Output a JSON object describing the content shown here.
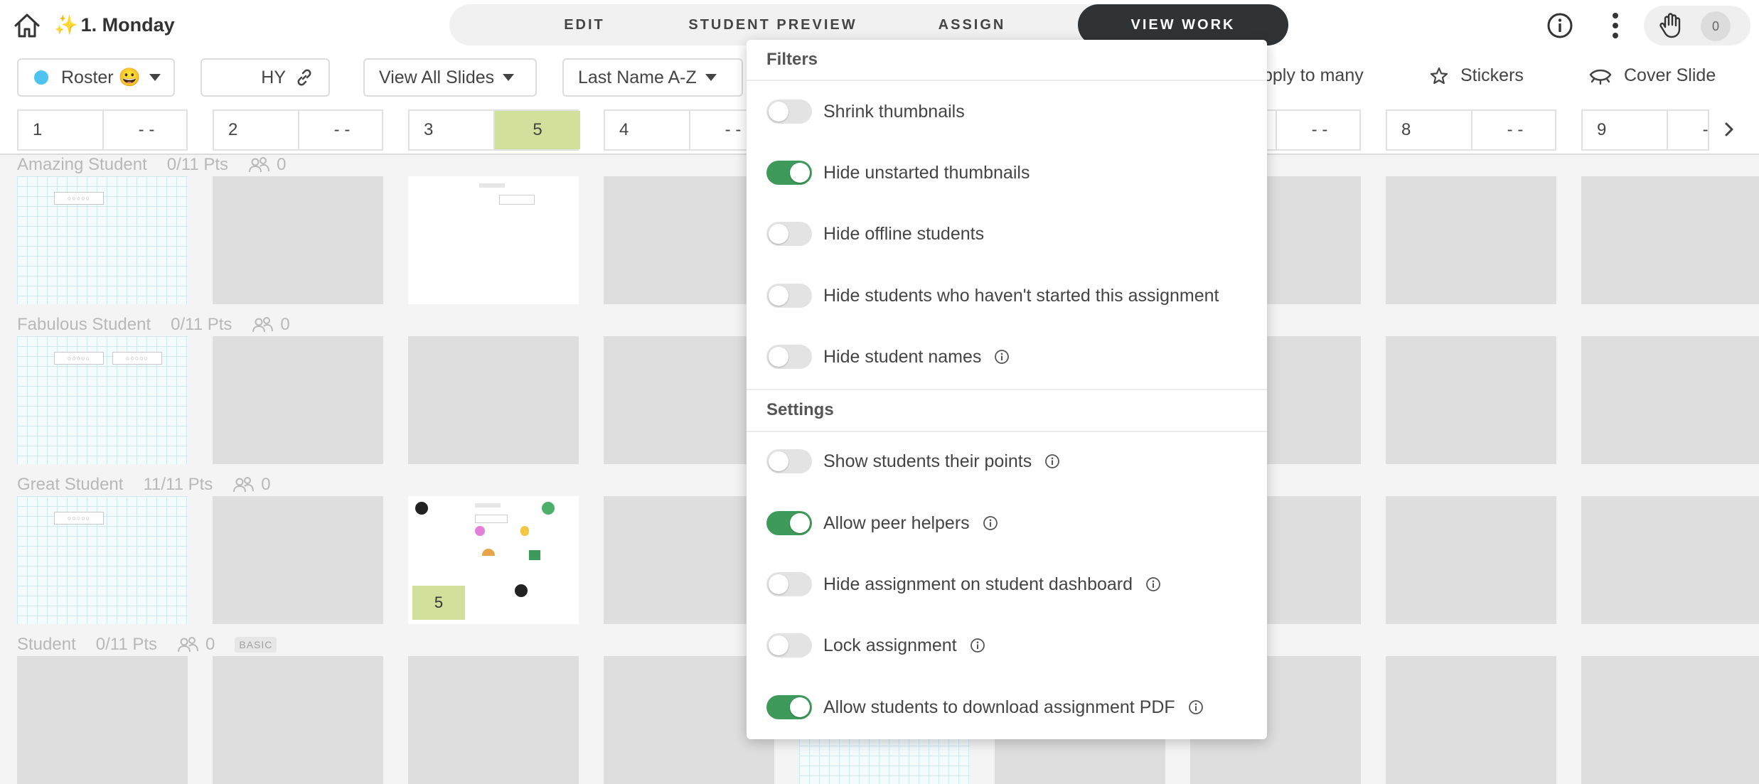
{
  "header": {
    "title": "1. Monday",
    "sparkle": "✨",
    "modes": [
      {
        "label": "EDIT",
        "active": false
      },
      {
        "label": "STUDENT PREVIEW",
        "active": false
      },
      {
        "label": "ASSIGN",
        "active": false
      },
      {
        "label": "VIEW WORK",
        "active": true
      }
    ],
    "hand_count": "0"
  },
  "toolbar": {
    "roster_label": "Roster 😀",
    "class_code": "HY",
    "slides_filter": "View All Slides",
    "sort": "Last Name A-Z",
    "apply_to_many": "pply to many",
    "stickers": "Stickers",
    "cover_slide": "Cover Slide"
  },
  "slides": [
    {
      "num": "1",
      "count": "- -"
    },
    {
      "num": "2",
      "count": "- -"
    },
    {
      "num": "3",
      "count": "5",
      "highlight": true
    },
    {
      "num": "4",
      "count": "- -"
    },
    {
      "num": "",
      "count": "- -"
    },
    {
      "num": "8",
      "count": "- -"
    },
    {
      "num": "9",
      "count": "- -"
    }
  ],
  "students": [
    {
      "name": "Amazing Student",
      "points": "0/11 Pts",
      "peers": "0"
    },
    {
      "name": "Fabulous Student",
      "points": "0/11 Pts",
      "peers": "0"
    },
    {
      "name": "Great Student",
      "points": "11/11 Pts",
      "peers": "0",
      "badge_score": "5"
    },
    {
      "name": "Student",
      "points": "0/11 Pts",
      "peers": "0",
      "tag": "BASIC"
    }
  ],
  "panel": {
    "filters_heading": "Filters",
    "filters": [
      {
        "label": "Shrink thumbnails",
        "on": false
      },
      {
        "label": "Hide unstarted thumbnails",
        "on": true
      },
      {
        "label": "Hide offline students",
        "on": false
      },
      {
        "label": "Hide students who haven't started this assignment",
        "on": false
      },
      {
        "label": "Hide student names",
        "on": false
      }
    ],
    "settings_heading": "Settings",
    "settings": [
      {
        "label": "Show students their points",
        "on": false
      },
      {
        "label": "Allow peer helpers",
        "on": true
      },
      {
        "label": "Hide assignment on student dashboard",
        "on": false
      },
      {
        "label": "Lock assignment",
        "on": false
      },
      {
        "label": "Allow students to download assignment PDF",
        "on": true
      }
    ]
  },
  "colors": {
    "accent_dark": "#2f3336",
    "toggle_on": "#3d9a5a",
    "highlight": "#d1e19b",
    "roster_dot": "#4ec3f0"
  }
}
